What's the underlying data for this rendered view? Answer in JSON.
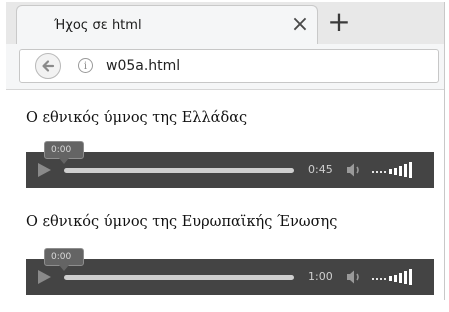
{
  "tab": {
    "title": "Ήχος σε html"
  },
  "address_bar": {
    "url": "w05a.html"
  },
  "content": {
    "sections": [
      {
        "heading": "Ο εθνικός ύμνος της Ελλάδας",
        "player": {
          "current_time": "0:00",
          "duration": "0:45",
          "progress": 0
        }
      },
      {
        "heading": "Ο εθνικός ύμνος της Ευρωπαϊκής Ένωσης",
        "player": {
          "current_time": "0:00",
          "duration": "1:00",
          "progress": 0
        }
      }
    ]
  }
}
